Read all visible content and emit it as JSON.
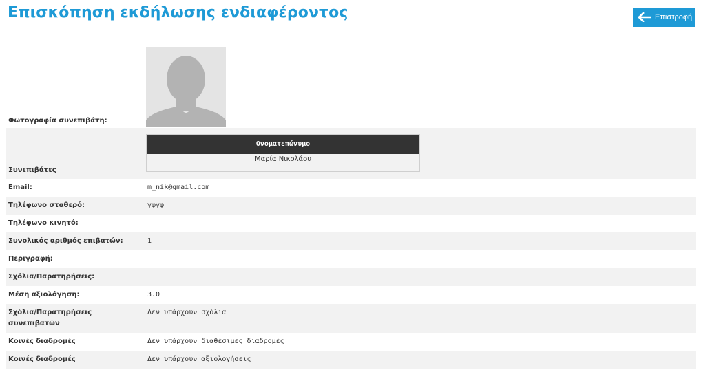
{
  "page": {
    "title": "Επισκόπηση εκδήλωσης ενδιαφέροντος",
    "back_label": "Επιστροφή"
  },
  "details": {
    "photo_label": "Φωτογραφία συνεπιβάτη:",
    "passengers_label": "Συνεπιβάτες",
    "passengers_header": "Ονοματεπώνυμο",
    "passengers": [
      "Μαρία Νικολάου"
    ],
    "rows": [
      {
        "label": "Email:",
        "value": "m_nik@gmail.com"
      },
      {
        "label": "Τηλέφωνο σταθερό:",
        "value": "γφγφ"
      },
      {
        "label": "Τηλέφωνο κινητό:",
        "value": ""
      },
      {
        "label": "Συνολικός αριθμός επιβατών:",
        "value": "1"
      },
      {
        "label": "Περιγραφή:",
        "value": ""
      },
      {
        "label": "Σχόλια/Παρατηρήσεις:",
        "value": ""
      },
      {
        "label": "Μέση αξιολόγηση:",
        "value": "3.0"
      },
      {
        "label": "Σχόλια/Παρατηρήσεις συνεπιβατών",
        "value": "Δεν υπάρχουν σχόλια"
      },
      {
        "label": "Κοινές διαδρομές",
        "value": "Δεν υπάρχουν διαθέσιμες διαδρομές"
      },
      {
        "label": "Κοινές διαδρομές",
        "value": "Δεν υπάρχουν αξιολογήσεις"
      }
    ]
  },
  "colors": {
    "accent": "#1e9ad6",
    "header_dark": "#333333",
    "row_alt": "#f2f2f2"
  },
  "icons": {
    "back": "arrow-left-icon",
    "avatar": "user-silhouette-icon"
  }
}
